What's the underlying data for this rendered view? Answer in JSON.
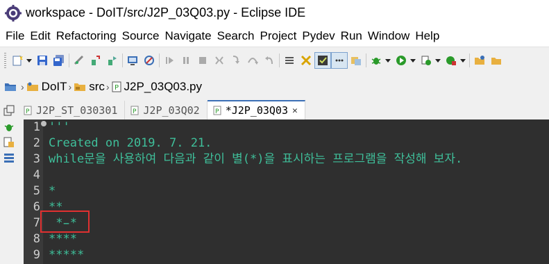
{
  "window": {
    "title": "workspace - DoIT/src/J2P_03Q03.py - Eclipse IDE"
  },
  "menu": [
    {
      "label": "File"
    },
    {
      "label": "Edit"
    },
    {
      "label": "Refactoring"
    },
    {
      "label": "Source"
    },
    {
      "label": "Navigate"
    },
    {
      "label": "Search"
    },
    {
      "label": "Project"
    },
    {
      "label": "Pydev"
    },
    {
      "label": "Run"
    },
    {
      "label": "Window"
    },
    {
      "label": "Help"
    }
  ],
  "breadcrumb": {
    "project": "DoIT",
    "folder": "src",
    "file": "J2P_03Q03.py"
  },
  "tabs": [
    {
      "label": "J2P_ST_030301"
    },
    {
      "label": "J2P_03Q02"
    },
    {
      "label": "*J2P_03Q03"
    }
  ],
  "editor": {
    "lines": [
      {
        "num": "1",
        "text": "'''"
      },
      {
        "num": "2",
        "text": "Created on 2019. 7. 21."
      },
      {
        "num": "3",
        "text": "while문을 사용하여 다음과 같이 별(*)을 표시하는 프로그램을 작성해 보자."
      },
      {
        "num": "4",
        "text": ""
      },
      {
        "num": "5",
        "text": "*"
      },
      {
        "num": "6",
        "text": "**"
      },
      {
        "num": "7",
        "text": " *̵*"
      },
      {
        "num": "8",
        "text": "****"
      },
      {
        "num": "9",
        "text": "*****"
      }
    ]
  },
  "colors": {
    "code_comment": "#3fbf9a",
    "editor_bg": "#2f2f2f",
    "highlight_box": "#e03030",
    "active_tab_border": "#3b6fb6"
  }
}
